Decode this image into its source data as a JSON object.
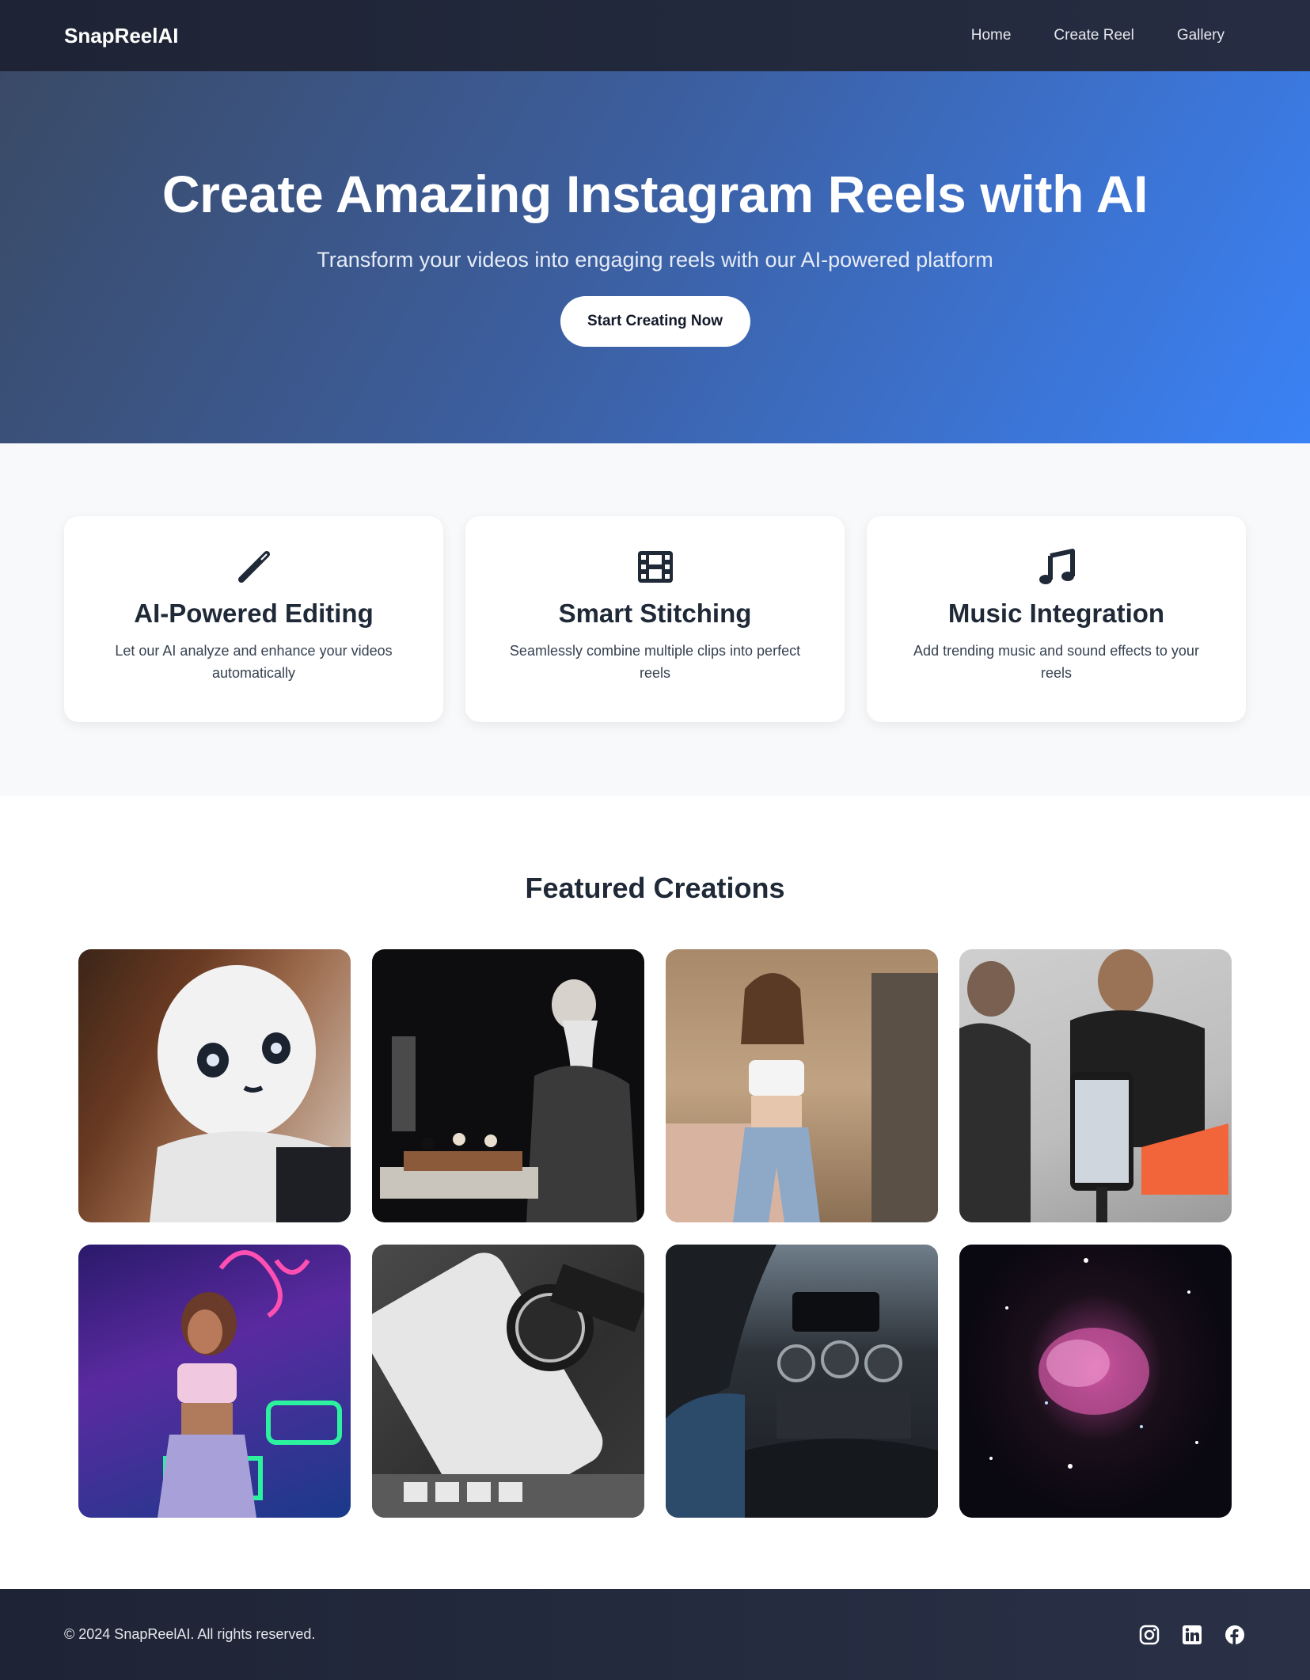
{
  "nav": {
    "brand": "SnapReelAI",
    "links": [
      "Home",
      "Create Reel",
      "Gallery"
    ]
  },
  "hero": {
    "title": "Create Amazing Instagram Reels with AI",
    "subtitle": "Transform your videos into engaging reels with our AI-powered platform",
    "cta": "Start Creating Now"
  },
  "features": [
    {
      "icon": "magic-wand-icon",
      "title": "AI-Powered Editing",
      "description": "Let our AI analyze and enhance your videos automatically"
    },
    {
      "icon": "film-icon",
      "title": "Smart Stitching",
      "description": "Seamlessly combine multiple clips into perfect reels"
    },
    {
      "icon": "music-note-icon",
      "title": "Music Integration",
      "description": "Add trending music and sound effects to your reels"
    }
  ],
  "gallery": {
    "title": "Featured Creations",
    "items": [
      "robot",
      "chess-player",
      "dancing-woman",
      "dancers-filming",
      "neon-dancer",
      "phone-and-watch",
      "car-interior",
      "nebula"
    ]
  },
  "footer": {
    "copyright": "© 2024 SnapReelAI. All rights reserved.",
    "socials": [
      "instagram-icon",
      "linkedin-icon",
      "facebook-icon"
    ]
  },
  "colors": {
    "nav_bg": "#1e2435",
    "hero_accent": "#3b82f6",
    "features_bg": "#f8f9fb",
    "icon_color": "#1f2937"
  }
}
